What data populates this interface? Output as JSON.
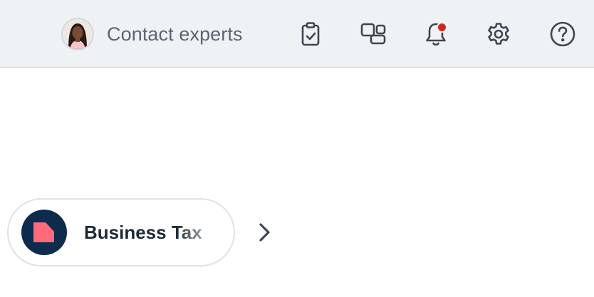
{
  "header": {
    "contact": {
      "label": "Contact experts",
      "avatar_icon": "expert-avatar"
    },
    "icons": [
      {
        "name": "clipboard-check-icon"
      },
      {
        "name": "devices-icon"
      },
      {
        "name": "bell-icon",
        "has_notification": true
      },
      {
        "name": "gear-icon"
      },
      {
        "name": "help-icon"
      }
    ],
    "colors": {
      "bar_background": "#eff2f5",
      "icon": "#3d4651",
      "notification_dot": "#d7261f"
    }
  },
  "carousel": {
    "active_item": {
      "label": "Business Tax",
      "icon": "business-tax-logo",
      "logo_bg": "#0d2b4c",
      "logo_accent": "#ff6b7a"
    },
    "next_icon": "chevron-right-icon"
  }
}
